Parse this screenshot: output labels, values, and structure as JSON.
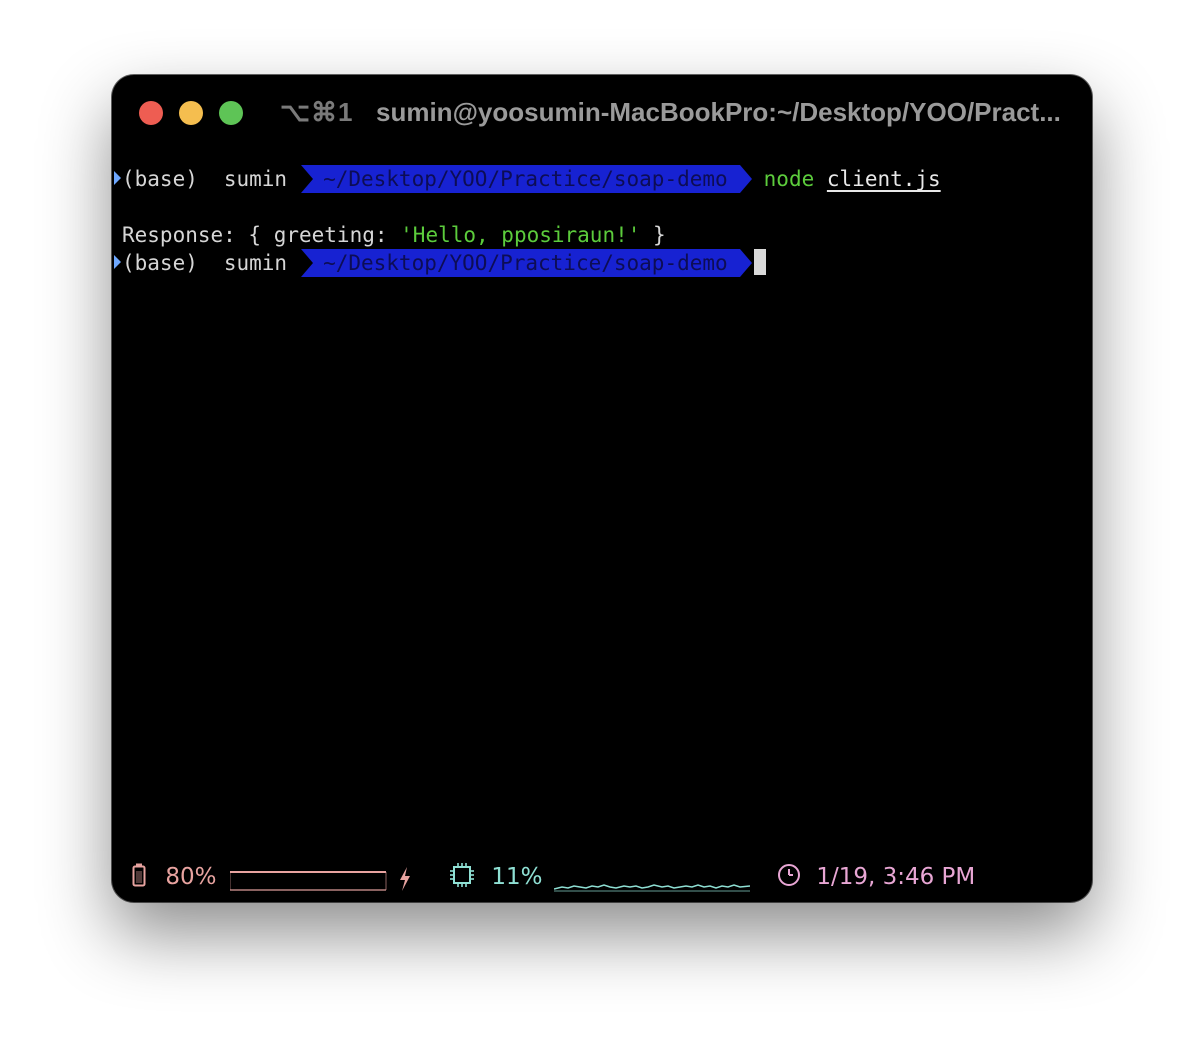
{
  "window": {
    "shortcut": "⌥⌘1",
    "title": "sumin@yoosumin-MacBookPro:~/Desktop/YOO/Pract..."
  },
  "terminal": {
    "lines": [
      {
        "env": "(base)",
        "user": "sumin",
        "path": "~/Desktop/YOO/Practice/soap-demo",
        "command": "node",
        "argument": "client.js"
      },
      {
        "output_prefix": "Response: { greeting: ",
        "output_string": "'Hello, pposiraun!'",
        "output_suffix": " }"
      },
      {
        "env": "(base)",
        "user": "sumin",
        "path": "~/Desktop/YOO/Practice/soap-demo"
      }
    ]
  },
  "statusbar": {
    "battery": {
      "icon": "battery-icon",
      "value": "80%",
      "level": 0.8,
      "charging_icon": "lightning-icon",
      "color": "#e8a3a0"
    },
    "cpu": {
      "icon": "cpu-chip-icon",
      "value": "11%",
      "color": "#8fe0d4"
    },
    "clock": {
      "icon": "clock-icon",
      "value": "1/19, 3:46 PM",
      "color": "#e8a6d4"
    }
  },
  "colors": {
    "path_bg": "#1722d2",
    "command_green": "#5ccc3c",
    "traffic_close": "#ee5d52",
    "traffic_min": "#f5be4f",
    "traffic_max": "#5ec456"
  }
}
